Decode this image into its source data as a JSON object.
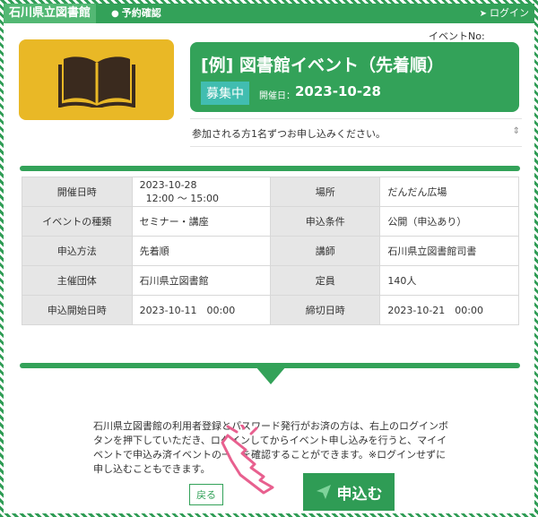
{
  "header": {
    "brand": "石川県立図書館",
    "reserve_label": "予約確認",
    "login_label": "ログイン"
  },
  "event": {
    "no_label": "イベントNo:",
    "title": "[例] 図書館イベント（先着順）",
    "status_badge": "募集中",
    "date_label": "開催日：",
    "date_value": "2023-10-28",
    "notice": "参加される方1名ずつお申し込みください。"
  },
  "details": {
    "rows": [
      {
        "h1": "開催日時",
        "v1": "2023-10-28\n  12:00 〜 15:00",
        "h2": "場所",
        "v2": "だんだん広場"
      },
      {
        "h1": "イベントの種類",
        "v1": "セミナー・講座",
        "h2": "申込条件",
        "v2": "公開（申込あり）"
      },
      {
        "h1": "申込方法",
        "v1": "先着順",
        "h2": "講師",
        "v2": "石川県立図書館司書"
      },
      {
        "h1": "主催団体",
        "v1": "石川県立図書館",
        "h2": "定員",
        "v2": "140人"
      },
      {
        "h1": "申込開始日時",
        "v1": "2023-10-11　00:00",
        "h2": "締切日時",
        "v2": "2023-10-21　00:00"
      }
    ]
  },
  "footer": {
    "description": "石川県立図書館の利用者登録とパスワード発行がお済の方は、右上のログインボタンを押下していただき、ログインしてからイベント申し込みを行うと、マイイベントで申込み済イベントの一覧を確認することができます。※ログインせずに申し込むこともできます。",
    "back_label": "戻る",
    "apply_label": "申込む"
  },
  "colors": {
    "primary": "#33a259",
    "logo_bg": "#e9b826",
    "badge": "#41bdb0"
  },
  "icons": {
    "reserve": "user-icon",
    "login": "login-icon",
    "logo": "open-book-icon",
    "apply": "paper-plane-icon",
    "pointer": "pointing-hand-icon"
  }
}
